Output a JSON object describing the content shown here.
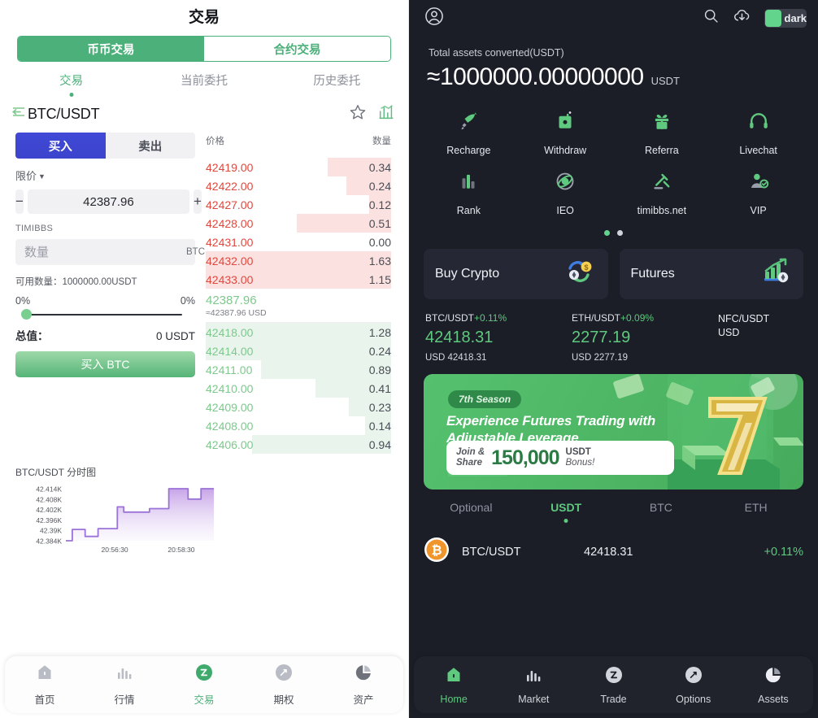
{
  "left": {
    "title": "交易",
    "segments": [
      {
        "label": "币币交易",
        "active": true
      },
      {
        "label": "合约交易",
        "active": false
      }
    ],
    "subtabs": [
      {
        "label": "交易",
        "active": true
      },
      {
        "label": "当前委托",
        "active": false
      },
      {
        "label": "历史委托",
        "active": false
      }
    ],
    "pair": "BTC/USDT",
    "icons": {
      "back": "back-arrow-icon",
      "fav": "star-icon",
      "kline": "chart-bars-icon"
    },
    "form": {
      "buy_label": "买入",
      "sell_label": "卖出",
      "order_type": "限价",
      "minus": "−",
      "plus": "+",
      "price_value": "42387.96",
      "brand": "TIMIBBS",
      "amount_placeholder": "数量",
      "amount_value": "",
      "amount_unit": "BTC",
      "available_label": "可用数量：1000000.00USDT",
      "pct_left": "0%",
      "pct_right": "0%",
      "total_label": "总值：",
      "total_value": "0 USDT",
      "submit_label": "买入 BTC"
    },
    "book": {
      "col_price": "价格",
      "col_amount": "数量",
      "asks": [
        {
          "price": "42419.00",
          "amount": "0.34",
          "depth": 34
        },
        {
          "price": "42422.00",
          "amount": "0.24",
          "depth": 24
        },
        {
          "price": "42427.00",
          "amount": "0.12",
          "depth": 12
        },
        {
          "price": "42428.00",
          "amount": "0.51",
          "depth": 51
        },
        {
          "price": "42431.00",
          "amount": "0.00",
          "depth": 0
        },
        {
          "price": "42432.00",
          "amount": "1.63",
          "depth": 100
        },
        {
          "price": "42433.00",
          "amount": "1.15",
          "depth": 100
        }
      ],
      "last_price": "42387.96",
      "last_usd": "≈42387.96 USD",
      "bids": [
        {
          "price": "42418.00",
          "amount": "1.28",
          "depth": 100
        },
        {
          "price": "42414.00",
          "amount": "0.24",
          "depth": 100
        },
        {
          "price": "42411.00",
          "amount": "0.89",
          "depth": 70
        },
        {
          "price": "42410.00",
          "amount": "0.41",
          "depth": 41
        },
        {
          "price": "42409.00",
          "amount": "0.23",
          "depth": 23
        },
        {
          "price": "42408.00",
          "amount": "0.14",
          "depth": 14
        },
        {
          "price": "42406.00",
          "amount": "0.94",
          "depth": 75
        }
      ]
    },
    "tabbar": [
      {
        "label": "首页",
        "icon": "home-icon",
        "active": false
      },
      {
        "label": "行情",
        "icon": "market-bars-icon",
        "active": false
      },
      {
        "label": "交易",
        "icon": "trade-icon",
        "active": true
      },
      {
        "label": "期权",
        "icon": "options-icon",
        "active": false
      },
      {
        "label": "资产",
        "icon": "assets-pie-icon",
        "active": false
      }
    ]
  },
  "chart_data": {
    "type": "line",
    "title": "BTC/USDT 分时图",
    "xlabel": "",
    "ylabel": "",
    "ytick_labels": [
      "42.414K",
      "42.408K",
      "42.402K",
      "42.396K",
      "42.39K",
      "42.384K"
    ],
    "ylim": [
      42384,
      42414
    ],
    "xtick_labels": [
      "20:56:30",
      "20:58:30"
    ],
    "grid": false,
    "legend": "none",
    "line_color": "#9b72d8",
    "fill": "gradient purple to white",
    "x": [
      0,
      1,
      2,
      3,
      4,
      5,
      6,
      7,
      8,
      9,
      10,
      11,
      12,
      13,
      14,
      15,
      16,
      17,
      18,
      19,
      20,
      21,
      22,
      23
    ],
    "values": [
      42384.0,
      42390.5,
      42390.5,
      42386.5,
      42386.5,
      42391.0,
      42391.0,
      42391.0,
      42403.5,
      42400.5,
      42400.5,
      42400.5,
      42400.5,
      42402.5,
      42402.5,
      42402.5,
      42414.0,
      42414.0,
      42414.0,
      42408.0,
      42408.0,
      42414.0,
      42414.0,
      42414.0
    ]
  },
  "right": {
    "topbar": {
      "avatar": "user-avatar-icon",
      "search": "search-icon",
      "download": "download-cloud-icon",
      "theme_label": "dark"
    },
    "assets": {
      "label": "Total assets converted(USDT)",
      "value": "≈1000000.00000000",
      "unit": "USDT"
    },
    "grid": [
      {
        "label": "Recharge",
        "icon": "rocket-icon"
      },
      {
        "label": "Withdraw",
        "icon": "withdraw-safe-icon"
      },
      {
        "label": "Referra",
        "icon": "gift-icon"
      },
      {
        "label": "Livechat",
        "icon": "headset-icon"
      },
      {
        "label": "Rank",
        "icon": "rank-bars-icon"
      },
      {
        "label": "IEO",
        "icon": "atom-icon"
      },
      {
        "label": "timibbs.net",
        "icon": "gavel-icon"
      },
      {
        "label": "VIP",
        "icon": "vip-user-icon"
      }
    ],
    "pager": {
      "count": 2,
      "active": 0
    },
    "cards": [
      {
        "title": "Buy Crypto",
        "icon": "swap-coin-icon"
      },
      {
        "title": "Futures",
        "icon": "growth-chart-icon"
      }
    ],
    "tickers": [
      {
        "pair": "BTC/USDT",
        "change": "+0.11%",
        "price": "42418.31",
        "sub": "USD 42418.31"
      },
      {
        "pair": "ETH/USDT",
        "change": "+0.09%",
        "price": "2277.19",
        "sub": "USD 2277.19"
      },
      {
        "line1": "NFC/USDT",
        "line2": "USD"
      }
    ],
    "banner": {
      "season": "7th Season",
      "headline": "Experience Futures Trading with Adjustable Leverage",
      "join": "Join &\nShare",
      "amount": "150,000",
      "usdt": "USDT",
      "bonus": "Bonus!",
      "big_number": "7"
    },
    "market_tabs": [
      {
        "label": "Optional",
        "active": false
      },
      {
        "label": "USDT",
        "active": true
      },
      {
        "label": "BTC",
        "active": false
      },
      {
        "label": "ETH",
        "active": false
      }
    ],
    "market_rows": [
      {
        "icon": "bitcoin-icon",
        "pair": "BTC/USDT",
        "price": "42418.31",
        "change": "+0.11%"
      }
    ],
    "tabbar": [
      {
        "label": "Home",
        "icon": "home-icon",
        "active": true
      },
      {
        "label": "Market",
        "icon": "market-bars-icon",
        "active": false
      },
      {
        "label": "Trade",
        "icon": "trade-icon",
        "active": false
      },
      {
        "label": "Options",
        "icon": "options-icon",
        "active": false
      },
      {
        "label": "Assets",
        "icon": "assets-pie-icon",
        "active": false
      }
    ]
  }
}
